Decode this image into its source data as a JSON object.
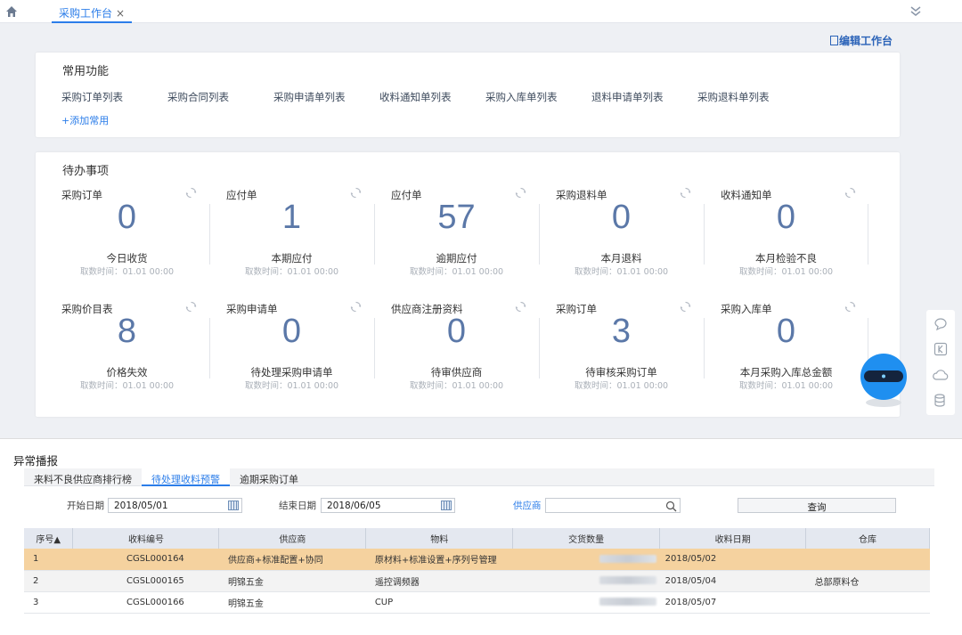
{
  "topbar": {
    "tab_label": "采购工作台",
    "close_glyph": "×"
  },
  "workspace": {
    "edit_label": "编辑工作台",
    "common": {
      "title": "常用功能",
      "links": [
        "采购订单列表",
        "采购合同列表",
        "采购申请单列表",
        "收料通知单列表",
        "采购入库单列表",
        "退料申请单列表",
        "采购退料单列表"
      ],
      "add_label": "+添加常用"
    },
    "todo": {
      "title": "待办事项",
      "row1": [
        {
          "title": "采购订单",
          "num": "0",
          "label": "今日收货",
          "time": "取数时间：01.01 00:00"
        },
        {
          "title": "应付单",
          "num": "1",
          "label": "本期应付",
          "time": "取数时间：01.01 00:00"
        },
        {
          "title": "应付单",
          "num": "57",
          "label": "逾期应付",
          "time": "取数时间：01.01 00:00"
        },
        {
          "title": "采购退料单",
          "num": "0",
          "label": "本月退料",
          "time": "取数时间：01.01 00:00"
        },
        {
          "title": "收料通知单",
          "num": "0",
          "label": "本月检验不良",
          "time": "取数时间：01.01 00:00"
        }
      ],
      "row2": [
        {
          "title": "采购价目表",
          "num": "8",
          "label": "价格失效",
          "time": "取数时间：01.01 00:00"
        },
        {
          "title": "采购申请单",
          "num": "0",
          "label": "待处理采购申请单",
          "time": "取数时间：01.01 00:00"
        },
        {
          "title": "供应商注册资料",
          "num": "0",
          "label": "待审供应商",
          "time": "取数时间：01.01 00:00"
        },
        {
          "title": "采购订单",
          "num": "3",
          "label": "待审核采购订单",
          "time": "取数时间：01.01 00:00"
        },
        {
          "title": "采购入库单",
          "num": "0",
          "label": "本月采购入库总金额",
          "time": "取数时间：01.01 00:00"
        }
      ]
    }
  },
  "exceptions": {
    "title": "异常播报",
    "tabs": [
      "来料不良供应商排行榜",
      "待处理收料预警",
      "逾期采购订单"
    ],
    "active_tab": 1,
    "filters": {
      "start_label": "开始日期",
      "start_value": "2018/05/01",
      "end_label": "结束日期",
      "end_value": "2018/06/05",
      "supplier_label": "供应商",
      "supplier_value": "",
      "query_label": "查询"
    },
    "columns": [
      "序号▲",
      "收料编号",
      "供应商",
      "物料",
      "交货数量",
      "收料日期",
      "仓库"
    ],
    "rows": [
      {
        "seq": "1",
        "code": "CGSL000164",
        "supplier": "供应商+标准配置+协同",
        "material": "原材料+标准设置+序列号管理",
        "qty": "",
        "date": "2018/05/02",
        "warehouse": ""
      },
      {
        "seq": "2",
        "code": "CGSL000165",
        "supplier": "明锦五金",
        "material": "遥控调频器",
        "qty": "",
        "date": "2018/05/04",
        "warehouse": "总部原料仓"
      },
      {
        "seq": "3",
        "code": "CGSL000166",
        "supplier": "明锦五金",
        "material": "CUP",
        "qty": "",
        "date": "2018/05/07",
        "warehouse": ""
      }
    ]
  },
  "colors": {
    "accent": "#2b7de9",
    "number": "#5b78a8",
    "selected_row": "#f5d29f"
  }
}
